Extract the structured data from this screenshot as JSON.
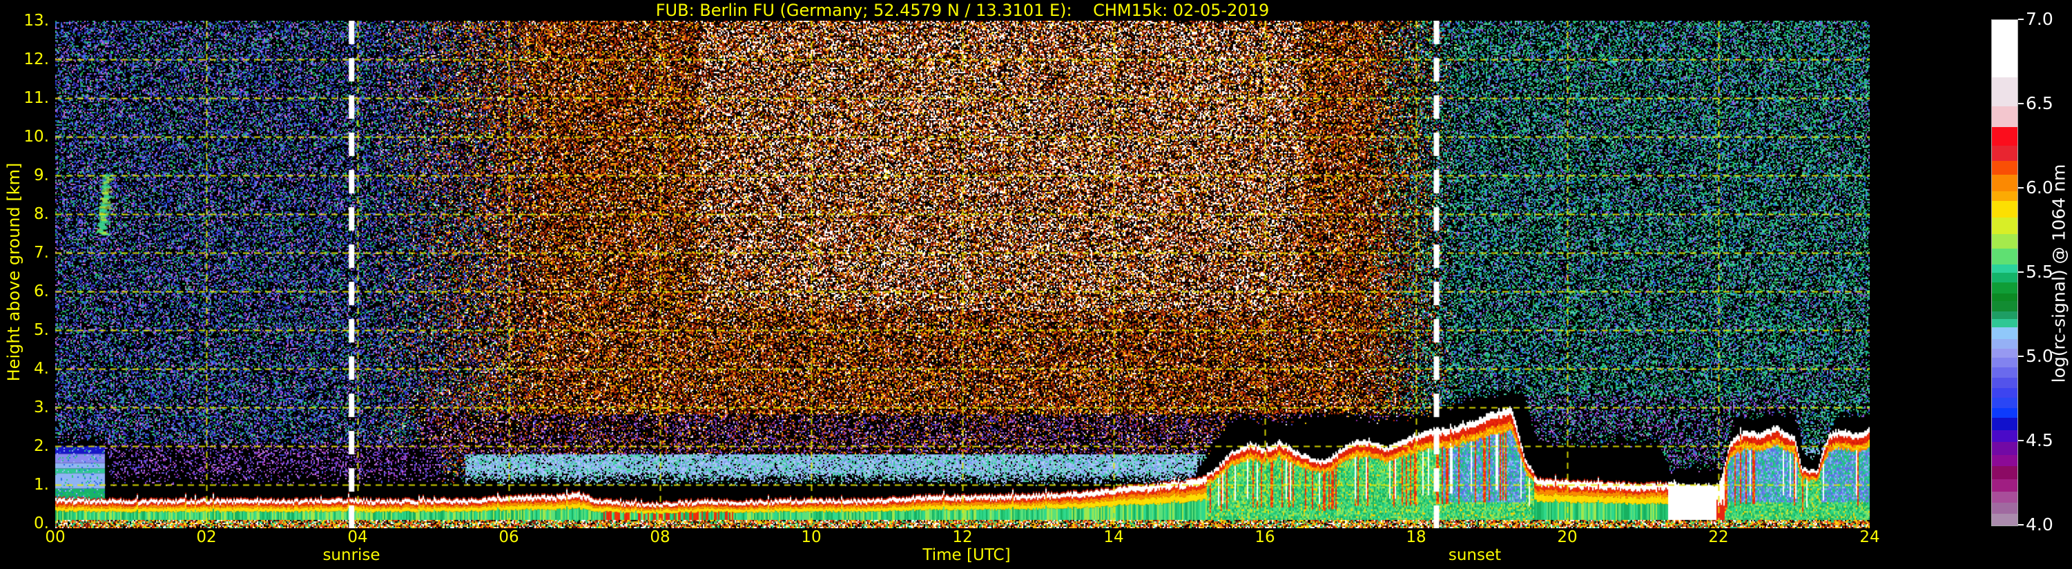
{
  "title": "FUB: Berlin FU (Germany; 52.4579 N / 13.3101 E):    CHM15k: 02-05-2019",
  "axes": {
    "x": {
      "label": "Time [UTC]",
      "tick_labels": [
        "00",
        "02",
        "04",
        "06",
        "08",
        "10",
        "12",
        "14",
        "16",
        "18",
        "20",
        "22",
        "24"
      ],
      "tick_hours": [
        0,
        2,
        4,
        6,
        8,
        10,
        12,
        14,
        16,
        18,
        20,
        22,
        24
      ]
    },
    "y": {
      "label": "Height above ground [km]",
      "tick_labels": [
        "0.",
        "1.",
        "2.",
        "3.",
        "4.",
        "5.",
        "6.",
        "7.",
        "8.",
        "9.",
        "10.",
        "11.",
        "12.",
        "13."
      ],
      "tick_km": [
        0,
        1,
        2,
        3,
        4,
        5,
        6,
        7,
        8,
        9,
        10,
        11,
        12,
        13
      ]
    }
  },
  "sun_markers": {
    "sunrise": {
      "label": "sunrise",
      "hour": 3.92
    },
    "sunset": {
      "label": "sunset",
      "hour": 18.27
    }
  },
  "colorbar": {
    "label": "log(rc-signal) @ 1064 nm",
    "tick_labels": [
      "7.0",
      "6.5",
      "6.0",
      "5.5",
      "5.0",
      "4.5",
      "4.0"
    ],
    "tick_values": [
      7.0,
      6.5,
      6.0,
      5.5,
      5.0,
      4.5,
      4.0
    ],
    "range": [
      4.0,
      7.0
    ],
    "bands_top_to_bottom": [
      [
        85,
        "#ffffff"
      ],
      [
        44,
        "#eee2e9"
      ],
      [
        30,
        "#f3c6ce"
      ],
      [
        28,
        "#fb0d1c"
      ],
      [
        23,
        "#e82530"
      ],
      [
        20,
        "#f94f05"
      ],
      [
        25,
        "#fb8902"
      ],
      [
        15,
        "#fcaa03"
      ],
      [
        24,
        "#fcdf02"
      ],
      [
        25,
        "#d8ee27"
      ],
      [
        22,
        "#a5ea4c"
      ],
      [
        23,
        "#5fe072"
      ],
      [
        13,
        "#2bd39c"
      ],
      [
        14,
        "#14b469"
      ],
      [
        16,
        "#0f9d36"
      ],
      [
        12,
        "#0c8a24"
      ],
      [
        15,
        "#128c32"
      ],
      [
        12,
        "#1e9e64"
      ],
      [
        12,
        "#2fc795"
      ],
      [
        17,
        "#90c8fa"
      ],
      [
        15,
        "#95b0f5"
      ],
      [
        13,
        "#9799f1"
      ],
      [
        15,
        "#8283ef"
      ],
      [
        15,
        "#6a6aed"
      ],
      [
        15,
        "#5353eb"
      ],
      [
        15,
        "#3d44f0"
      ],
      [
        15,
        "#2a46f5"
      ],
      [
        15,
        "#0d3bfd"
      ],
      [
        18,
        "#1111cc"
      ],
      [
        18,
        "#4a0ac8"
      ],
      [
        19,
        "#7209a5"
      ],
      [
        17,
        "#8c0a96"
      ],
      [
        19,
        "#8c0a64"
      ],
      [
        19,
        "#a01e82"
      ],
      [
        16,
        "#a84e9a"
      ],
      [
        17,
        "#a06aa0"
      ],
      [
        17,
        "#ab8bad"
      ]
    ]
  },
  "colors": {
    "background": "#000000",
    "text_yellow": "#fbfb00",
    "grid_yellow": "#e9e900",
    "text_white": "#ffffff",
    "sun_line_white": "#ffffff"
  },
  "chart_data": {
    "type": "heatmap",
    "title": "FUB: Berlin FU (Germany; 52.4579 N / 13.3101 E):    CHM15k: 02-05-2019",
    "x_axis": {
      "label": "Time [UTC]",
      "range_hours": [
        0,
        24
      ],
      "grid_step_hours": 2
    },
    "y_axis": {
      "label": "Height above ground [km]",
      "range_km": [
        0,
        13
      ],
      "grid_step_km": 1
    },
    "value": {
      "label": "log(rc-signal) @ 1064 nm",
      "range": [
        4.0,
        7.0
      ]
    },
    "sunrise_hour": 3.92,
    "sunset_hour": 18.27,
    "grid_km": [
      1,
      2,
      3,
      4,
      5,
      6,
      7,
      8,
      9,
      10,
      11,
      12
    ],
    "grid_hours": [
      2,
      4,
      6,
      8,
      10,
      12,
      14,
      16,
      18,
      20,
      22
    ],
    "aerosol_layer_top_km": [
      [
        0,
        0.63
      ],
      [
        1,
        0.6
      ],
      [
        2,
        0.62
      ],
      [
        3,
        0.6
      ],
      [
        3.9,
        0.62
      ],
      [
        4.5,
        0.6
      ],
      [
        5.5,
        0.62
      ],
      [
        6.2,
        0.72
      ],
      [
        6.6,
        0.7
      ],
      [
        6.9,
        0.8
      ],
      [
        7.1,
        0.65
      ],
      [
        7.5,
        0.55
      ],
      [
        8,
        0.52
      ],
      [
        8.6,
        0.6
      ],
      [
        9,
        0.57
      ],
      [
        10,
        0.62
      ],
      [
        10.5,
        0.6
      ],
      [
        11,
        0.65
      ],
      [
        11.5,
        0.7
      ],
      [
        12.5,
        0.72
      ],
      [
        13,
        0.75
      ],
      [
        13.5,
        0.8
      ],
      [
        14,
        0.9
      ],
      [
        14.5,
        1.0
      ],
      [
        15,
        1.1
      ],
      [
        15.3,
        1.3
      ],
      [
        15.55,
        1.85
      ],
      [
        15.8,
        2.05
      ],
      [
        16,
        1.9
      ],
      [
        16.2,
        2.1
      ],
      [
        16.5,
        1.75
      ],
      [
        16.8,
        1.6
      ],
      [
        17.1,
        2.05
      ],
      [
        17.35,
        2.15
      ],
      [
        17.6,
        1.95
      ],
      [
        17.9,
        2.2
      ],
      [
        18.15,
        2.4
      ],
      [
        18.45,
        2.45
      ],
      [
        18.7,
        2.6
      ],
      [
        19,
        2.85
      ],
      [
        19.25,
        3.0
      ],
      [
        19.45,
        1.6
      ],
      [
        19.6,
        1.15
      ],
      [
        20,
        1.1
      ],
      [
        20.6,
        1.05
      ],
      [
        21,
        1.0
      ],
      [
        21.3,
        1.05
      ],
      [
        22,
        1.0
      ],
      [
        22.15,
        2.1
      ],
      [
        22.35,
        2.4
      ],
      [
        22.55,
        2.3
      ],
      [
        22.75,
        2.5
      ],
      [
        23,
        2.2
      ],
      [
        23.1,
        1.4
      ],
      [
        23.3,
        1.35
      ],
      [
        23.45,
        2.3
      ],
      [
        23.6,
        2.4
      ],
      [
        23.8,
        2.3
      ],
      [
        24,
        2.45
      ]
    ],
    "noise_floor_km": [
      [
        0,
        2.0
      ],
      [
        0.64,
        2.0
      ],
      [
        0.74,
        0.95
      ],
      [
        4,
        1.0
      ],
      [
        15,
        1.0
      ],
      [
        15.55,
        2.6
      ],
      [
        16.3,
        2.5
      ],
      [
        16.8,
        2.75
      ],
      [
        17.4,
        2.6
      ],
      [
        18.1,
        2.7
      ],
      [
        18.4,
        2.95
      ],
      [
        19,
        3.25
      ],
      [
        19.4,
        3.25
      ],
      [
        19.6,
        2.0
      ],
      [
        21.2,
        2.0
      ],
      [
        21.35,
        1.3
      ],
      [
        22.05,
        1.3
      ],
      [
        22.2,
        2.6
      ],
      [
        23,
        2.7
      ],
      [
        23.15,
        1.55
      ],
      [
        23.4,
        1.8
      ],
      [
        23.55,
        2.7
      ],
      [
        24,
        2.7
      ]
    ],
    "features": [
      {
        "name": "nocturnal-low-column",
        "hours": [
          0,
          0.65
        ],
        "km": [
          0.6,
          2.0
        ],
        "desc": "strong echo column: emerald / light-blue / periwinkle bands with dark-blue cap"
      },
      {
        "name": "cirrus-fall-streak",
        "hour": 0.62,
        "km": [
          7.5,
          9.05
        ],
        "desc": "tilted green streak"
      },
      {
        "name": "surface-aerosol-layer",
        "desc": "stacked green/yellow/orange/red/white bands below layer top, black gap above"
      },
      {
        "name": "daytime-glow-band",
        "hours": [
          5.4,
          15.3
        ],
        "km": [
          1.0,
          1.8
        ],
        "desc": "periwinkle solar-background glow"
      },
      {
        "name": "afternoon-clouds",
        "hours": [
          15.5,
          18.1
        ],
        "km": [
          1.4,
          2.2
        ],
        "desc": "white cloud tops, red fringes, green interior"
      },
      {
        "name": "post-sunset-plume",
        "hours": [
          18.2,
          19.4
        ],
        "km": [
          2.2,
          3.0
        ],
        "desc": "rising plume, blue-green interior"
      },
      {
        "name": "evening-stratus-band",
        "hours": [
          19.6,
          21.3
        ],
        "km": [
          1.0,
          1.15
        ]
      },
      {
        "name": "white-cloud-blob",
        "hours": [
          21.35,
          22.05
        ],
        "km": [
          0,
          1.05
        ]
      },
      {
        "name": "late-evening-towers",
        "hours": [
          22.1,
          23.05
        ],
        "km": [
          0,
          2.5
        ]
      },
      {
        "name": "late-night-structures",
        "hours": [
          23.3,
          24
        ],
        "km": [
          0,
          2.45
        ]
      }
    ],
    "render": {
      "night_high": [
        "#2137c8",
        "#2d6fe0",
        "#27c87d",
        "#23a04e",
        "#6f78e8",
        "#2a1e96",
        "#4a3ad0",
        "#d06ad0"
      ],
      "night_low_purple": [
        "#6a3ad0",
        "#8a55e0",
        "#9a2ea8",
        "#4a4ad8",
        "#c87ae0"
      ],
      "day_warm": [
        "#c02408",
        "#e05a10",
        "#ee9118",
        "#ffffff",
        "#7c1c06",
        "#ffd400",
        "#b03810",
        "#58120a"
      ],
      "day_glow": [
        "#8fb2f4",
        "#9dbef8",
        "#7e9af0",
        "#b4ccfa",
        "#2fc795",
        "#66d8b4"
      ],
      "evening": [
        "#1db45f",
        "#2ad08e",
        "#1fa0c0",
        "#2a64e0",
        "#22903c",
        "#64d0b4",
        "#8c55d8"
      ],
      "layer_greens": [
        "#24c874",
        "#2fd88c",
        "#5ce07a",
        "#a0e84e",
        "#17b060"
      ],
      "layer_blues": [
        "#7a8af0",
        "#5f6eea",
        "#2fc795",
        "#27b7b7",
        "#24c270",
        "#88c0f6"
      ],
      "bottom_strip": [
        "#000000",
        "#e84010",
        "#f0a020",
        "#ffd400",
        "#ffffff",
        "#28cc7c",
        "#70180c"
      ]
    }
  }
}
